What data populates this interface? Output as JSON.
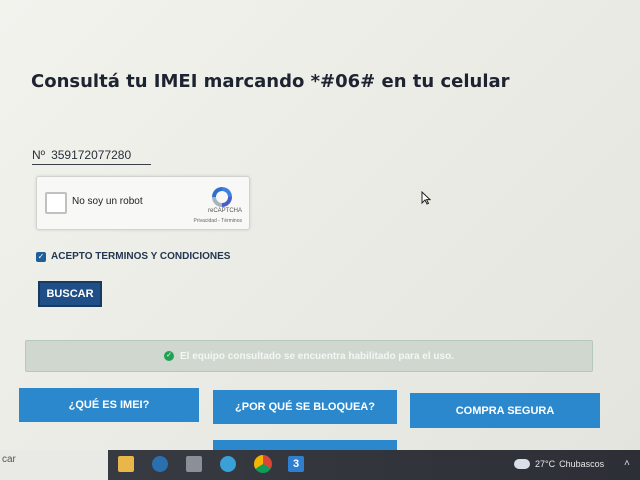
{
  "title": "Consultá tu IMEI marcando *#06# en tu celular",
  "imei": {
    "prefix": "Nº",
    "value": "359172077280"
  },
  "captcha": {
    "label": "No soy un robot",
    "brand": "reCAPTCHA",
    "links": "Privacidad - Términos",
    "icon": "recaptcha-logo-icon"
  },
  "terms": {
    "label": "ACEPTO TERMINOS Y CONDICIONES",
    "checked": true
  },
  "search_button": "BUSCAR",
  "status_message": "El equipo consultado se encuentra habilitado para el uso.",
  "info_buttons": [
    "¿QUÉ ES IMEI?",
    "¿POR QUÉ SE BLOQUEA?",
    "COMPRA SEGURA"
  ],
  "taskbar": {
    "search_text": "car",
    "apps": [
      "file-explorer-icon",
      "clock-app-icon",
      "calculator-icon",
      "network-app-icon",
      "chrome-icon",
      "css-editor-icon"
    ],
    "weather": {
      "temp": "27°C",
      "condition": "Chubascos"
    }
  },
  "colors": {
    "accent": "#2c88cc",
    "primary_dark": "#1f4f86",
    "success": "#22a055",
    "title": "#1d2330"
  }
}
